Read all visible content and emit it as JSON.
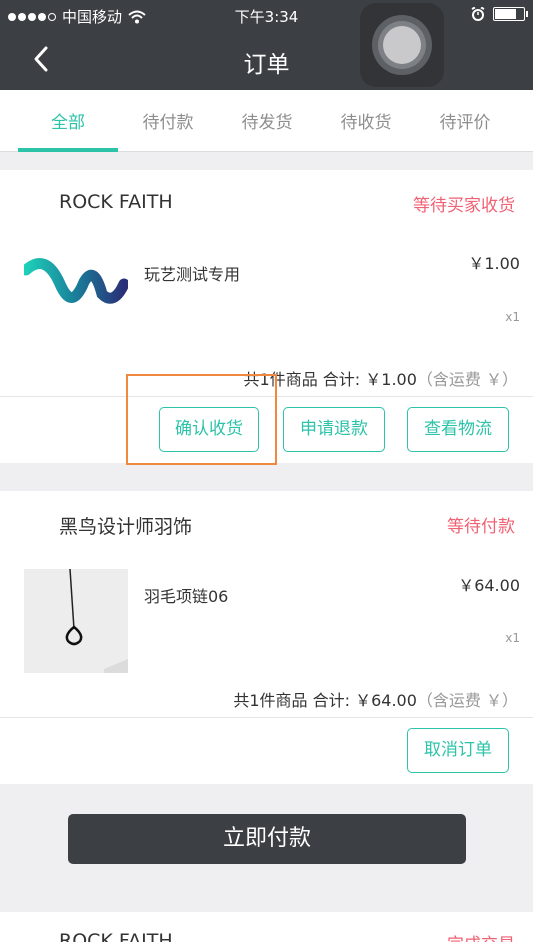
{
  "status_bar": {
    "carrier": "中国移动",
    "time": "下午3:34"
  },
  "nav": {
    "title": "订单"
  },
  "tabs": [
    {
      "label": "全部",
      "active": true
    },
    {
      "label": "待付款",
      "active": false
    },
    {
      "label": "待发货",
      "active": false
    },
    {
      "label": "待收货",
      "active": false
    },
    {
      "label": "待评价",
      "active": false
    }
  ],
  "orders": [
    {
      "shop": "ROCK FAITH",
      "status": "等待买家收货",
      "product_name": "玩艺测试专用",
      "price": "￥1.00",
      "qty": "x1",
      "summary_main": "共1件商品 合计: ￥1.00",
      "summary_note": "（含运费 ￥）",
      "buttons": [
        "确认收货",
        "申请退款",
        "查看物流"
      ]
    },
    {
      "shop": "黑鸟设计师羽饰",
      "status": "等待付款",
      "product_name": "羽毛项链06",
      "price": "￥64.00",
      "qty": "x1",
      "summary_main": "共1件商品 合计: ￥64.00",
      "summary_note": "（含运费 ￥）",
      "buttons": [
        "取消订单"
      ]
    },
    {
      "shop": "ROCK FAITH",
      "status": "完成交易"
    }
  ],
  "pay_button": "立即付款",
  "colors": {
    "accent": "#2cc3a8",
    "status_red": "#f06173",
    "header_dark": "#3c4044",
    "highlight": "#f0883f"
  }
}
